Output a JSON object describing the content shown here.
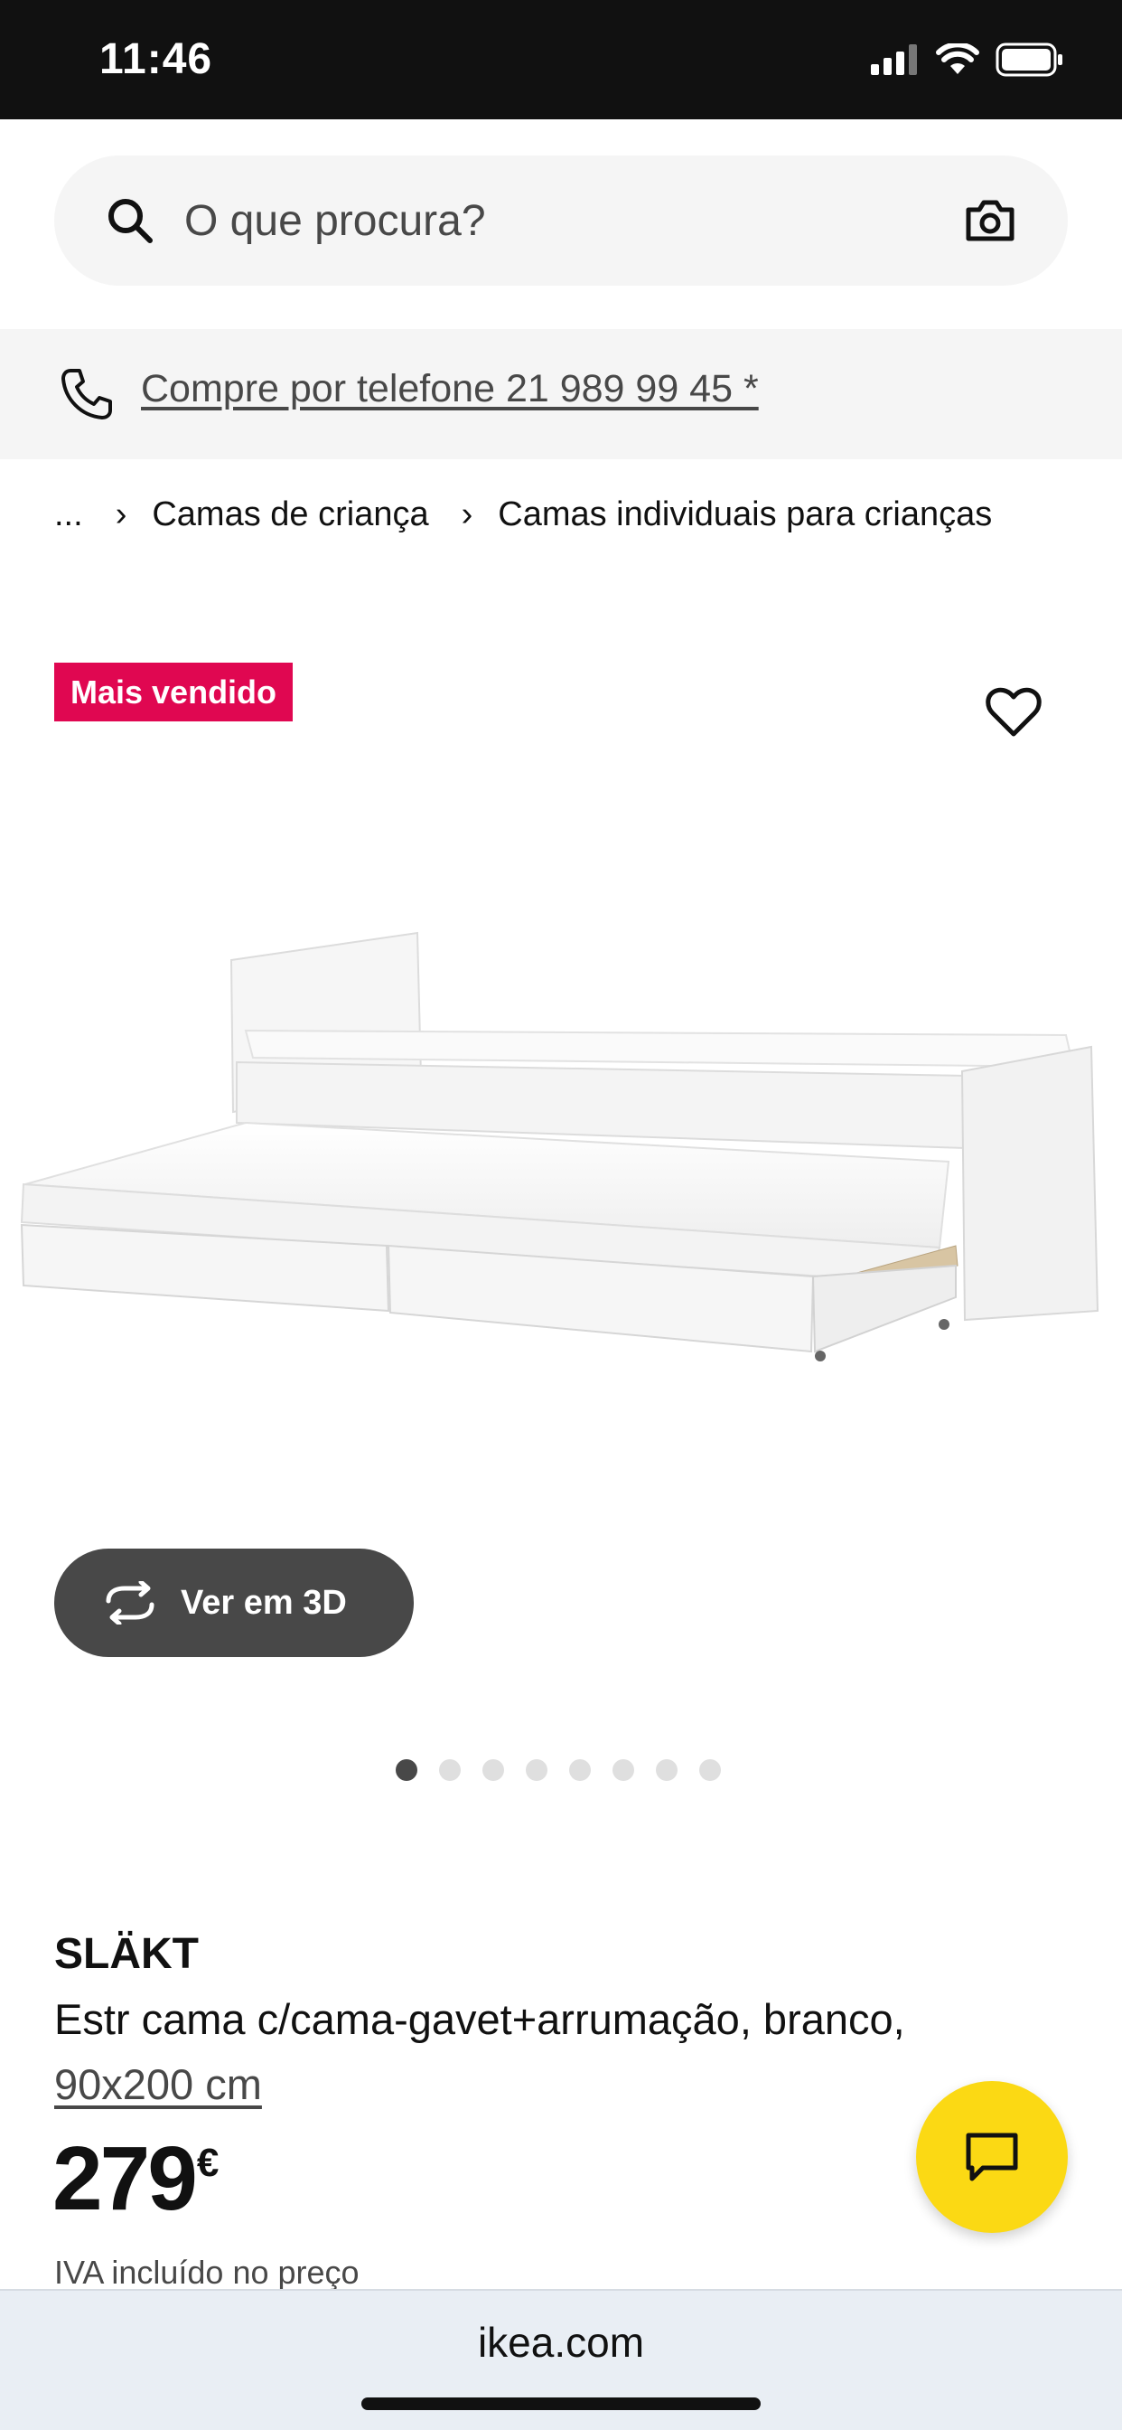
{
  "status_bar": {
    "time": "11:46"
  },
  "search": {
    "placeholder": "O que procura?"
  },
  "phone_banner": {
    "text": "Compre por telefone 21 989 99 45 *"
  },
  "breadcrumb": {
    "ellipsis": "...",
    "items": [
      "Camas de criança",
      "Camas individuais para crianças"
    ]
  },
  "badge": {
    "label": "Mais vendido"
  },
  "gallery": {
    "view3d_label": "Ver em 3D",
    "dot_count": 8,
    "active_index": 0
  },
  "product": {
    "name": "SLÄKT",
    "description": "Estr cama c/cama-gavet+arrumação, branco,",
    "size": "90x200 cm",
    "price": "279",
    "currency": "€",
    "vat_note": "IVA incluído no preço"
  },
  "browser": {
    "url": "ikea.com"
  },
  "colors": {
    "badge": "#e00751",
    "chat_button": "#fbd914",
    "dark_button": "#484848"
  }
}
